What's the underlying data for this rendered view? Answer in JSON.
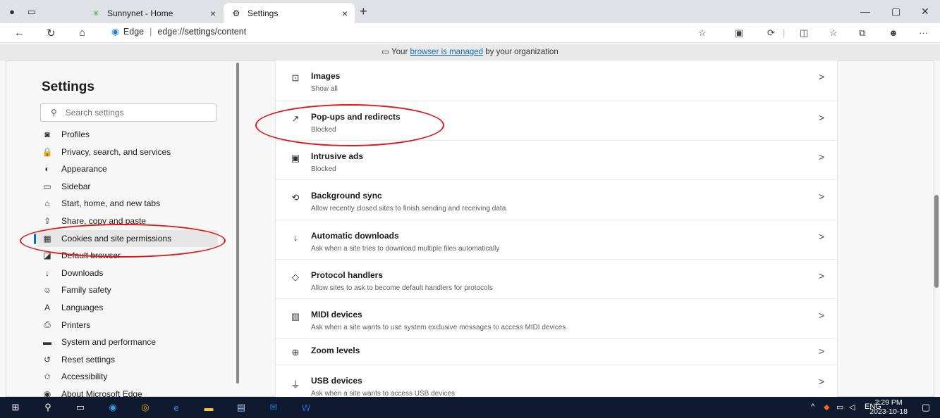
{
  "tabs": [
    {
      "title": "Sunnynet - Home",
      "close": "×"
    },
    {
      "title": "Settings",
      "close": "×"
    }
  ],
  "new_tab": "+",
  "window_controls": {
    "minimize": "—",
    "restore": "▢",
    "close": "✕"
  },
  "address": {
    "site_label": "Edge",
    "separator": "|",
    "url_prefix": "edge://",
    "url_bold": "settings",
    "url_suffix": "/content"
  },
  "more_menu": "···",
  "managed_banner": {
    "before": "Your",
    "link": "browser is managed",
    "after": "by your organization"
  },
  "sidebar": {
    "title": "Settings",
    "search_placeholder": "Search settings",
    "items": [
      {
        "label": "Profiles",
        "icon": "profiles-icon"
      },
      {
        "label": "Privacy, search, and services",
        "icon": "lock-icon"
      },
      {
        "label": "Appearance",
        "icon": "appearance-icon"
      },
      {
        "label": "Sidebar",
        "icon": "sidebar-icon"
      },
      {
        "label": "Start, home, and new tabs",
        "icon": "home-icon"
      },
      {
        "label": "Share, copy and paste",
        "icon": "share-icon"
      },
      {
        "label": "Cookies and site permissions",
        "icon": "cookies-icon",
        "selected": true
      },
      {
        "label": "Default browser",
        "icon": "default-browser-icon"
      },
      {
        "label": "Downloads",
        "icon": "download-icon"
      },
      {
        "label": "Family safety",
        "icon": "family-icon"
      },
      {
        "label": "Languages",
        "icon": "languages-icon"
      },
      {
        "label": "Printers",
        "icon": "printer-icon"
      },
      {
        "label": "System and performance",
        "icon": "system-icon"
      },
      {
        "label": "Reset settings",
        "icon": "reset-icon"
      },
      {
        "label": "Accessibility",
        "icon": "accessibility-icon"
      },
      {
        "label": "About Microsoft Edge",
        "icon": "edge-icon"
      }
    ]
  },
  "permissions": [
    {
      "title": "Images",
      "subtitle": "Show all",
      "icon": "image-icon"
    },
    {
      "title": "Pop-ups and redirects",
      "subtitle": "Blocked",
      "icon": "popup-icon"
    },
    {
      "title": "Intrusive ads",
      "subtitle": "Blocked",
      "icon": "ads-icon"
    },
    {
      "title": "Background sync",
      "subtitle": "Allow recently closed sites to finish sending and receiving data",
      "icon": "sync-icon"
    },
    {
      "title": "Automatic downloads",
      "subtitle": "Ask when a site tries to download multiple files automatically",
      "icon": "download-icon"
    },
    {
      "title": "Protocol handlers",
      "subtitle": "Allow sites to ask to become default handlers for protocols",
      "icon": "protocol-icon"
    },
    {
      "title": "MIDI devices",
      "subtitle": "Ask when a site wants to use system exclusive messages to access MIDI devices",
      "icon": "midi-icon"
    },
    {
      "title": "Zoom levels",
      "subtitle": "",
      "icon": "zoom-icon"
    },
    {
      "title": "USB devices",
      "subtitle": "Ask when a site wants to access USB devices",
      "icon": "usb-icon"
    }
  ],
  "chevron": ">",
  "taskbar": {
    "language": "ENG",
    "time": "2:29 PM",
    "date": "2023-10-18"
  },
  "colors": {
    "annotation": "#e01818",
    "accent": "#0f6cbd",
    "taskbar": "#0f1a2e"
  }
}
